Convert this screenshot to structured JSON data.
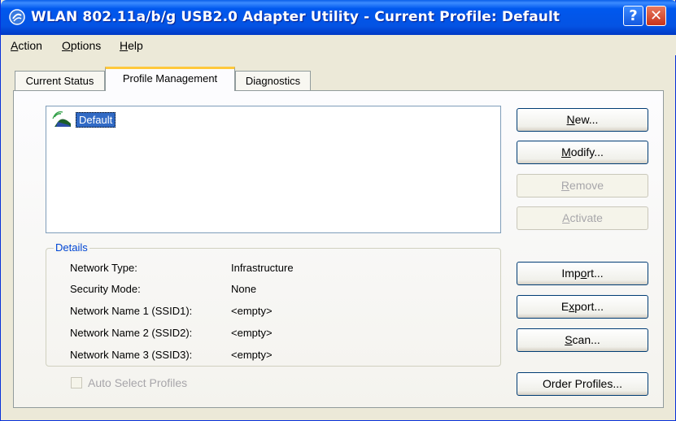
{
  "window": {
    "title": "WLAN 802.11a/b/g USB2.0 Adapter Utility - Current Profile: Default",
    "help_button": "?",
    "close_button": "✕"
  },
  "menu": [
    {
      "label": "Action",
      "accel": "A",
      "rest": "ction"
    },
    {
      "label": "Options",
      "accel": "O",
      "rest": "ptions"
    },
    {
      "label": "Help",
      "accel": "H",
      "rest": "elp"
    }
  ],
  "tabs": [
    {
      "label": "Current Status",
      "active": false
    },
    {
      "label": "Profile Management",
      "active": true
    },
    {
      "label": "Diagnostics",
      "active": false
    }
  ],
  "profiles": [
    {
      "name": "Default",
      "selected": true,
      "icon": "wireless-profile-icon"
    }
  ],
  "buttons": {
    "new": {
      "accel": "N",
      "rest": "ew...",
      "enabled": true
    },
    "modify": {
      "accel": "M",
      "rest": "odify...",
      "enabled": true
    },
    "remove": {
      "accel": "R",
      "rest": "emove",
      "enabled": false
    },
    "activate": {
      "accel": "A",
      "rest": "ctivate",
      "enabled": false
    },
    "import": {
      "pre": "Imp",
      "accel": "o",
      "rest": "rt...",
      "enabled": true
    },
    "export": {
      "pre": "E",
      "accel": "x",
      "rest": "port...",
      "enabled": true
    },
    "scan": {
      "accel": "S",
      "rest": "can...",
      "enabled": true
    },
    "order": {
      "label": "Order Profiles...",
      "enabled": true
    }
  },
  "details": {
    "legend": "Details",
    "rows": [
      {
        "label": "Network Type:",
        "value": "Infrastructure"
      },
      {
        "label": "Security Mode:",
        "value": "None"
      },
      {
        "label": "Network Name 1 (SSID1):",
        "value": "<empty>"
      },
      {
        "label": "Network Name 2 (SSID2):",
        "value": "<empty>"
      },
      {
        "label": "Network Name 3 (SSID3):",
        "value": "<empty>"
      }
    ]
  },
  "auto_select": {
    "label": "Auto Select Profiles",
    "checked": false,
    "enabled": false
  },
  "colors": {
    "titlebar": "#0058EE",
    "selection": "#316AC5",
    "legend": "#0046D5",
    "tab_highlight": "#FFC83C"
  }
}
